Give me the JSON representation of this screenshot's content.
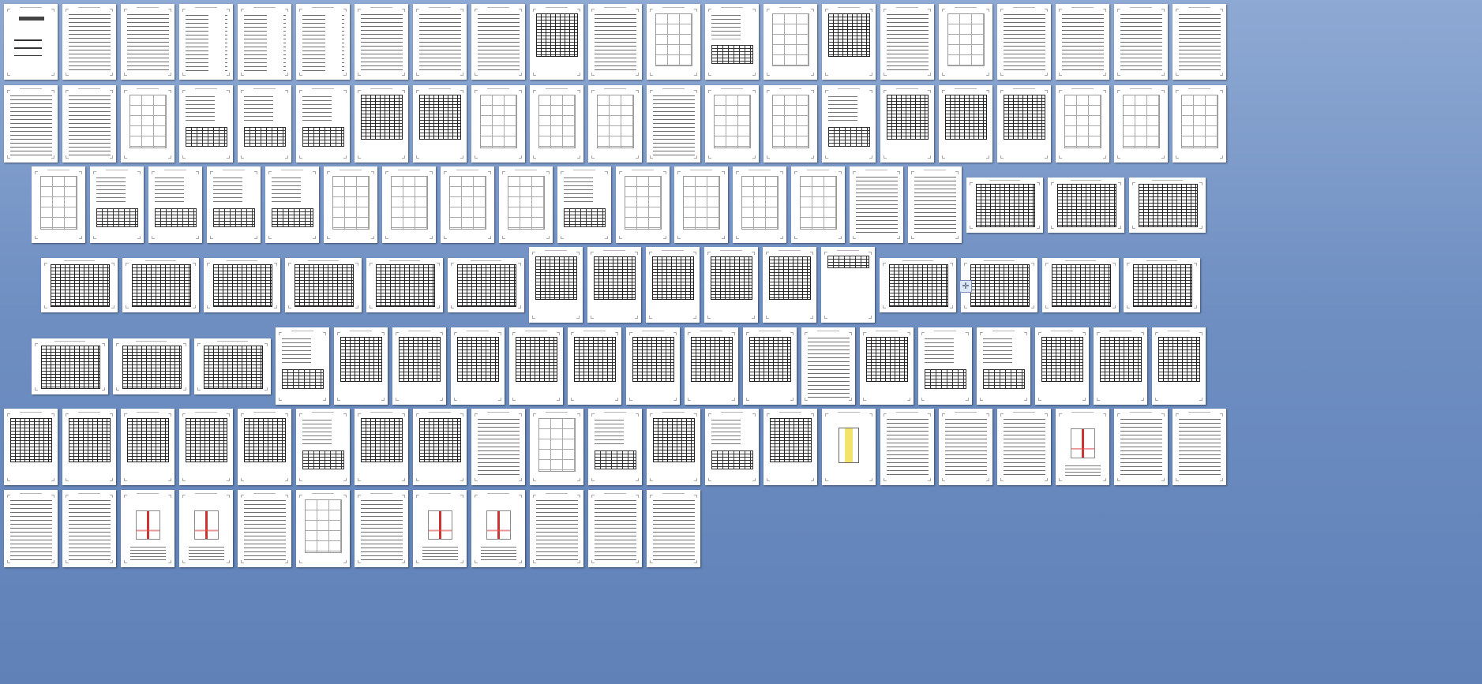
{
  "view": {
    "mode": "page-overview",
    "zoom_label": "",
    "background_color": "#6f8fc2"
  },
  "icons": {
    "move_handle": "move-cross-icon",
    "move_handle_glyph": "✛"
  },
  "rows": [
    {
      "types": [
        "cover",
        "text",
        "text",
        "toc",
        "toc",
        "toc",
        "text",
        "text",
        "text",
        "table",
        "text",
        "frame",
        "mixed",
        "frame",
        "table",
        "text",
        "frame",
        "text",
        "text",
        "text",
        "text"
      ]
    },
    {
      "types": [
        "text",
        "text",
        "frame",
        "mixed",
        "mixed",
        "mixed",
        "table",
        "table",
        "frame",
        "frame",
        "frame",
        "text",
        "frame",
        "frame",
        "mixed",
        "table",
        "table",
        "table",
        "frame",
        "frame",
        "frame"
      ]
    },
    {
      "types": [
        "frame",
        "mixed",
        "mixed",
        "mixed",
        "mixed",
        "frame",
        "frame",
        "frame",
        "frame",
        "mixed",
        "frame",
        "frame",
        "frame",
        "frame",
        "text",
        "text",
        "table-land",
        "table-land",
        "table-land"
      ]
    },
    {
      "types": [
        "table-land",
        "table-land",
        "table-land",
        "table-land",
        "table-land",
        "table-land",
        "table",
        "table",
        "table",
        "table",
        "table",
        "blank",
        "table-land",
        "table-land",
        "table-land",
        "table-land"
      ]
    },
    {
      "types": [
        "table-land",
        "table-land",
        "table-land",
        "mixed",
        "table",
        "table",
        "table",
        "table",
        "table",
        "table",
        "table",
        "table",
        "text",
        "table",
        "mixed",
        "mixed",
        "table",
        "table",
        "table"
      ]
    },
    {
      "types": [
        "table",
        "table",
        "table",
        "table",
        "table",
        "mixed",
        "table",
        "table",
        "text",
        "frame",
        "mixed",
        "table",
        "mixed",
        "table",
        "column",
        "text",
        "text",
        "text",
        "detail",
        "text",
        "text"
      ]
    },
    {
      "types": [
        "text",
        "text",
        "detail",
        "detail",
        "text",
        "frame",
        "text",
        "detail",
        "detail",
        "text",
        "text",
        "text"
      ]
    }
  ]
}
